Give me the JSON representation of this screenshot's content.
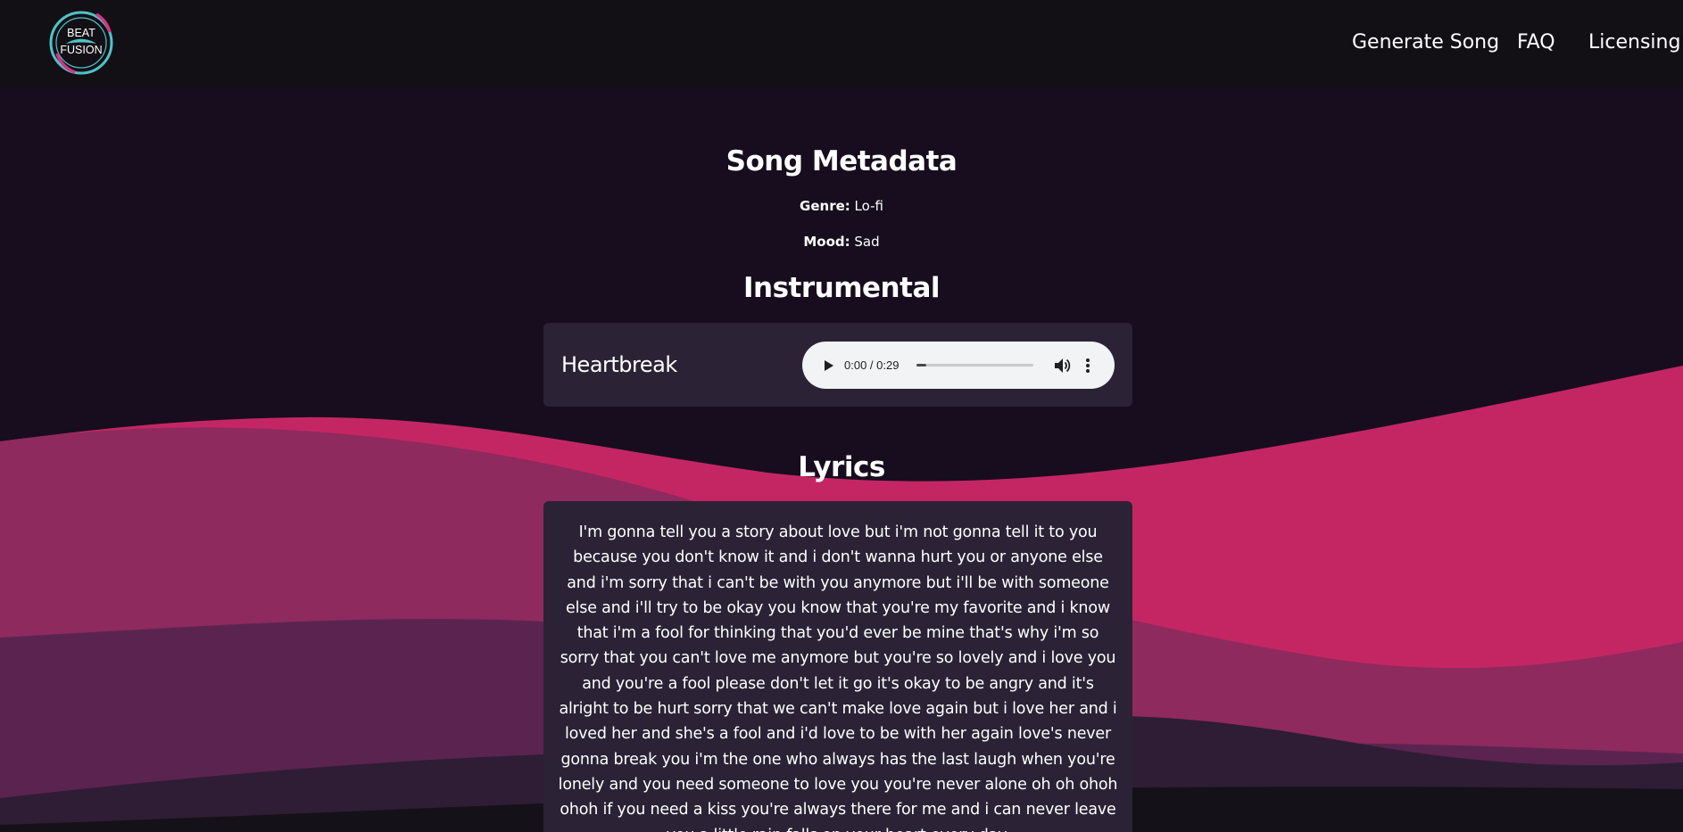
{
  "brand": {
    "logo_line1": "BEAT",
    "logo_line2": "FUSION"
  },
  "nav": {
    "items": [
      {
        "label": "Generate Song"
      },
      {
        "label": "FAQ"
      },
      {
        "label": "Licensing"
      }
    ]
  },
  "metadata": {
    "title": "Song Metadata",
    "genre_label": "Genre:",
    "genre_value": "Lo-fi",
    "mood_label": "Mood:",
    "mood_value": "Sad"
  },
  "instrumental": {
    "title": "Instrumental",
    "track_name": "Heartbreak",
    "player": {
      "time_display": "0:00 / 0:29",
      "played_fraction": 0.0,
      "play_icon": "play-icon",
      "volume_icon": "volume-icon",
      "more_icon": "more-vertical-icon"
    }
  },
  "lyrics": {
    "title": "Lyrics",
    "text": "I'm gonna tell you a story about love but i'm not gonna tell it to you because you don't know it and i don't wanna hurt you or anyone else and i'm sorry that i can't be with you anymore but i'll be with someone else and i'll try to be okay you know that you're my favorite and i know that i'm a fool for thinking that you'd ever be mine that's why i'm so sorry that you can't love me anymore but you're so lovely and i love you and you're a fool please don't let it go it's okay to be angry and it's alright to be hurt sorry that we can't make love again but i love her and i loved her and she's a fool and i'd love to be with her again love's never gonna break you i'm the one who always has the last laugh when you're lonely and you need someone to love you you're never alone oh oh ohoh ohoh if you need a kiss you're always there for me and i can never leave you a little rain falls on your heart every day."
  },
  "colors": {
    "background": "#170d1e",
    "navbar": "#121015",
    "card": "#2b2235",
    "wave_hot_pink": "#c42664",
    "wave_magenta": "#8e2a5e",
    "wave_plum": "#5b2450",
    "wave_dark_plum": "#2e1d34",
    "logo_teal": "#4fc3c7",
    "logo_pink": "#d63384"
  }
}
